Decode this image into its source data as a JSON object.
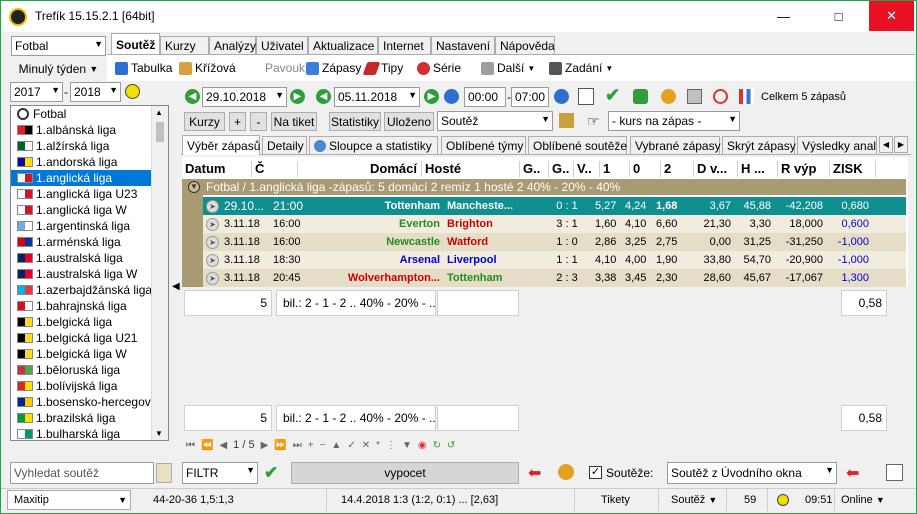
{
  "window": {
    "title": "Trefík 15.15.2.1 [64bit]"
  },
  "sport_select": {
    "value": "Fotbal"
  },
  "period_select": {
    "value": "Minulý týden"
  },
  "year_from": {
    "value": "2017"
  },
  "year_to": {
    "value": "2018"
  },
  "menu_tabs": [
    "Soutěž",
    "Kurzy",
    "Analýzy",
    "Uživatel",
    "Aktualizace",
    "Internet",
    "Nastavení",
    "Nápověda"
  ],
  "toolbar": {
    "tabulka": "Tabulka",
    "krizova": "Křížová",
    "pavouk": "Pavouk",
    "zapasy": "Zápasy",
    "tipy": "Tipy",
    "serie": "Série",
    "dalsi": "Další",
    "zadani": "Zadání"
  },
  "dates": {
    "from": "29.10.2018",
    "to": "05.11.2018",
    "time_from": "00:00",
    "time_to": "07:00"
  },
  "total_label": "Celkem 5 zápasů",
  "filter_bar": {
    "kurzy": "Kurzy",
    "plus": "+",
    "minus": "-",
    "na_tiket": "Na tiket",
    "statistiky": "Statistiky",
    "ulozeno": "Uloženo",
    "soutez_combo": "Soutěž",
    "kurs_combo": "- kurs na zápas -"
  },
  "view_tabs": [
    "Výběr zápasů",
    "Detaily",
    "Sloupce a statistiky",
    "Oblíbené týmy",
    "Oblíbené soutěže",
    "Vybrané zápasy",
    "Skrýt zápasy",
    "Výsledky analýz"
  ],
  "sidebar": {
    "root": "Fotbal",
    "leagues": [
      {
        "name": "1.albánská liga",
        "c1": "#e41e20",
        "c2": "#000000"
      },
      {
        "name": "1.alžírská liga",
        "c1": "#006233",
        "c2": "#ffffff"
      },
      {
        "name": "1.andorská liga",
        "c1": "#10069f",
        "c2": "#fedd00"
      },
      {
        "name": "1.anglická liga",
        "c1": "#ffffff",
        "c2": "#cf142b",
        "selected": true
      },
      {
        "name": "1.anglická liga U23",
        "c1": "#ffffff",
        "c2": "#cf142b"
      },
      {
        "name": "1.anglická liga W",
        "c1": "#ffffff",
        "c2": "#cf142b"
      },
      {
        "name": "1.argentinská liga",
        "c1": "#74acdf",
        "c2": "#ffffff"
      },
      {
        "name": "1.arménská liga",
        "c1": "#d90012",
        "c2": "#0033a0"
      },
      {
        "name": "1.australská liga",
        "c1": "#012169",
        "c2": "#e4002b"
      },
      {
        "name": "1.australská liga W",
        "c1": "#012169",
        "c2": "#e4002b"
      },
      {
        "name": "1.azerbajdžánská liga",
        "c1": "#00b5e2",
        "c2": "#ef3340"
      },
      {
        "name": "1.bahrajnská liga",
        "c1": "#ce1126",
        "c2": "#ffffff"
      },
      {
        "name": "1.belgická liga",
        "c1": "#000000",
        "c2": "#fdda24"
      },
      {
        "name": "1.belgická liga U21",
        "c1": "#000000",
        "c2": "#fdda24"
      },
      {
        "name": "1.belgická liga W",
        "c1": "#000000",
        "c2": "#fdda24"
      },
      {
        "name": "1.běloruská liga",
        "c1": "#c8313e",
        "c2": "#4aa657"
      },
      {
        "name": "1.bolívijská liga",
        "c1": "#d52b1e",
        "c2": "#f9e300"
      },
      {
        "name": "1.bosensko-hercegov",
        "c1": "#002395",
        "c2": "#fecb00"
      },
      {
        "name": "1.brazilská liga",
        "c1": "#009c3b",
        "c2": "#ffdf00"
      },
      {
        "name": "1.bulharská liga",
        "c1": "#ffffff",
        "c2": "#00966e"
      }
    ]
  },
  "search": {
    "placeholder": "Vyhledat soutěž"
  },
  "grid": {
    "headers": [
      "Datum",
      "Č",
      "Domácí",
      "Hosté",
      "G..",
      "G..",
      "V..",
      "1",
      "0",
      "2",
      "D v...",
      "H ...",
      "R výp",
      "ZISK"
    ],
    "group_label": "Fotbal / 1.anglická liga -zápasů: 5  domácí 2  remíz 1  hosté 2      40% - 20% - 40%",
    "rows": [
      {
        "date": "29.10...",
        "time": "21:00",
        "home": "Tottenham",
        "away": "Mancheste...",
        "score": "0 : 1",
        "o1": "5,27",
        "o0": "4,24",
        "o2": "1,68",
        "d": "3,67",
        "h": "45,88",
        "r": "-42,208",
        "zisk": "0,680",
        "sel": true
      },
      {
        "date": "3.11.18",
        "time": "16:00",
        "home": "Everton",
        "away": "Brighton",
        "score": "3 : 1",
        "o1": "1,60",
        "o0": "4,10",
        "o2": "6,60",
        "d": "21,30",
        "h": "3,30",
        "r": "18,000",
        "zisk": "0,600"
      },
      {
        "date": "3.11.18",
        "time": "16:00",
        "home": "Newcastle",
        "away": "Watford",
        "score": "1 : 0",
        "o1": "2,86",
        "o0": "3,25",
        "o2": "2,75",
        "d": "0,00",
        "h": "31,25",
        "r": "-31,250",
        "zisk": "-1,000"
      },
      {
        "date": "3.11.18",
        "time": "18:30",
        "home": "Arsenal",
        "away": "Liverpool",
        "score": "1 : 1",
        "o1": "4,10",
        "o0": "4,00",
        "o2": "1,90",
        "d": "33,80",
        "h": "54,70",
        "r": "-20,900",
        "zisk": "-1,000"
      },
      {
        "date": "3.11.18",
        "time": "20:45",
        "home": "Wolverhampton...",
        "away": "Tottenham",
        "score": "2 : 3",
        "o1": "3,38",
        "o0": "3,45",
        "o2": "2,30",
        "d": "28,60",
        "h": "45,67",
        "r": "-17,067",
        "zisk": "1,300"
      }
    ]
  },
  "summary1": {
    "count": "5",
    "text": "bil.: 2 - 1 - 2 .. 40% - 20% - ...",
    "value": "0,58"
  },
  "summary2": {
    "count": "5",
    "text": "bil.: 2 - 1 - 2 .. 40% - 20% - ...",
    "value": "0,58"
  },
  "pager": {
    "page": "1 / 5"
  },
  "bottom": {
    "filtr": "FILTR",
    "vypocet": "vypocet",
    "soutez_check": "Soutěže:",
    "soutez_source": "Soutěž z Úvodního okna"
  },
  "statusbar": {
    "left": "Maxitip",
    "odds": "44-20-36  1,5:1,3",
    "match": "14.4.2018 1:3 (1:2, 0:1) ... [2,63]",
    "tikety": "Tikety",
    "soutez": "Soutěž",
    "num": "59",
    "time": "09:51",
    "online": "Online"
  }
}
